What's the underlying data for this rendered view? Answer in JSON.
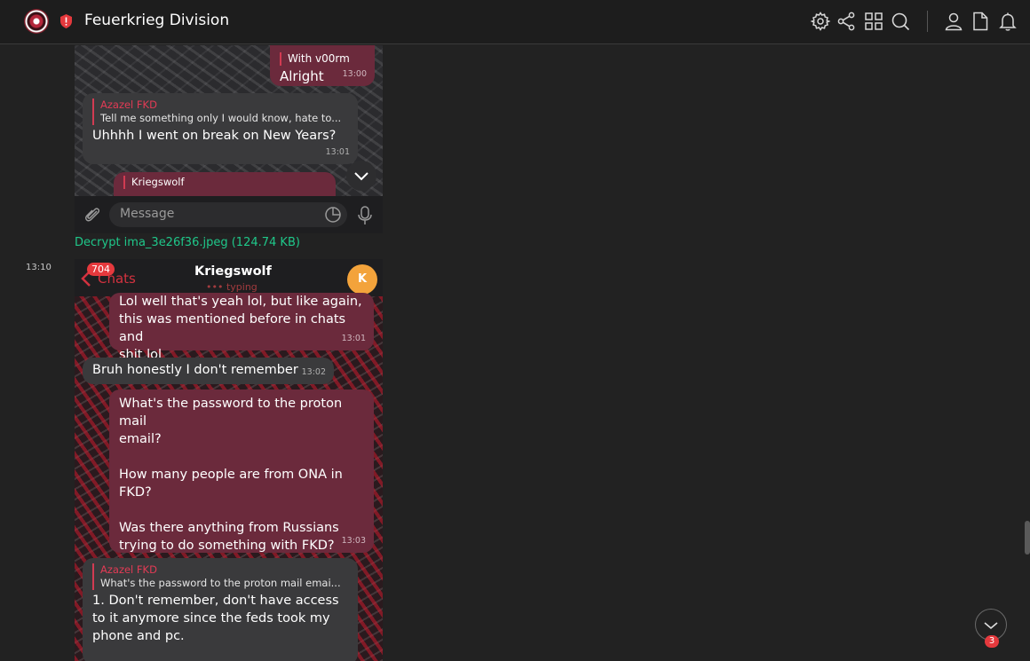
{
  "header": {
    "title": "Feuerkrieg Division",
    "icons": [
      "settings-icon",
      "share-icon",
      "grid-icon",
      "search-icon",
      "user-icon",
      "document-icon",
      "bell-icon"
    ]
  },
  "feed": {
    "attachment_link": "Decrypt ima_3e26f36.jpeg (124.74 KB)",
    "post_time": "13:10"
  },
  "screenshot1": {
    "messages": [
      {
        "reply_text": "With v00rm",
        "text": "Alright",
        "time": "13:00"
      },
      {
        "reply_name": "Azazel FKD",
        "reply_text": "Tell me something only I would know, hate to...",
        "text": "Uhhhh I went on break on New Years?",
        "time": "13:01"
      },
      {
        "reply_name": "Kriegswolf"
      }
    ],
    "composer_placeholder": "Message"
  },
  "screenshot2": {
    "header": {
      "badge": "704",
      "back_label": "Chats",
      "title": "Kriegswolf",
      "status": "typing",
      "avatar_letter": "K"
    },
    "messages": [
      {
        "text": "Lol well that's yeah lol, but like again,\nthis was mentioned before in chats and\nshit lol",
        "time": "13:01"
      },
      {
        "text": "Bruh honestly I don't remember",
        "time": "13:02"
      },
      {
        "text": "What's the password to the proton mail\nemail?\n\nHow many people are from ONA in\nFKD?\n\nWas there anything from Russians\ntrying to do something with FKD?",
        "time": "13:03"
      },
      {
        "reply_name": "Azazel FKD",
        "reply_text": "What's the password to the proton mail emai...",
        "text": "1. Don't remember, don't have access\nto it anymore since the feds took my\nphone and pc."
      }
    ]
  },
  "scroll_badge": "3",
  "colors": {
    "accent_link": "#1fc88a",
    "badge": "#e5393d",
    "outgoing_bubble": "#6b2a3c",
    "incoming_bubble": "#3a3a3c",
    "avatar": "#f3a33b"
  }
}
